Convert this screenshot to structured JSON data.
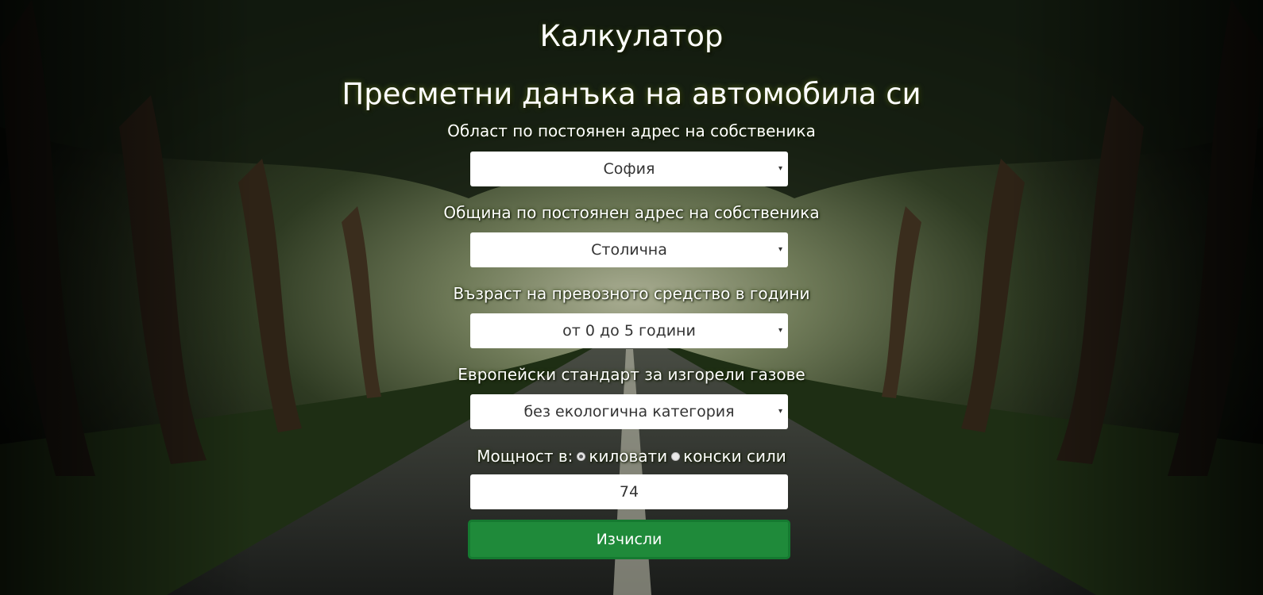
{
  "header": {
    "app_title": "Калкулатор",
    "page_title": "Пресметни данъка на автомобила си"
  },
  "form": {
    "region": {
      "label": "Област по постоянен адрес на собственика",
      "selected": "София"
    },
    "municipality": {
      "label": "Община по постоянен адрес на собственика",
      "selected": "Столична"
    },
    "vehicle_age": {
      "label": "Възраст на превозното средство в години",
      "selected": "от 0 до 5 години"
    },
    "emission_standard": {
      "label": "Европейски стандарт за изгорели газове",
      "selected": "без екологична категория"
    },
    "power": {
      "label": "Мощност в:",
      "unit_kw": "киловати",
      "unit_hp": "конски сили",
      "selected_unit": "киловати",
      "value": "74"
    },
    "submit_label": "Изчисли"
  },
  "icons": {
    "select_caret": "▾"
  },
  "colors": {
    "button_green": "#1f8a3a",
    "button_border": "#157a30",
    "field_background": "#ffffff",
    "text_light": "#ffffff"
  }
}
